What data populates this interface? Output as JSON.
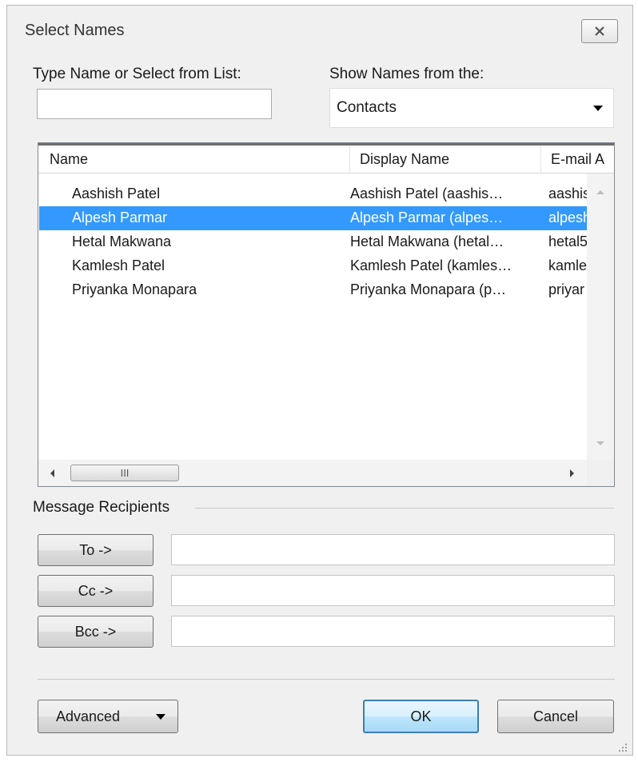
{
  "dialog": {
    "title": "Select Names"
  },
  "search": {
    "label": "Type Name or Select from List:",
    "value": ""
  },
  "address_book": {
    "label": "Show Names from the:",
    "selected": "Contacts"
  },
  "list": {
    "columns": [
      "Name",
      "Display Name",
      "E-mail A"
    ],
    "rows": [
      {
        "name": "Aashish Patel",
        "display": "Aashish Patel (aashis…",
        "email": "aashis",
        "selected": false
      },
      {
        "name": "Alpesh Parmar",
        "display": "Alpesh Parmar (alpes…",
        "email": "alpesh",
        "selected": true
      },
      {
        "name": "Hetal Makwana",
        "display": "Hetal Makwana (hetal…",
        "email": "hetal5",
        "selected": false
      },
      {
        "name": "Kamlesh Patel",
        "display": "Kamlesh Patel (kamles…",
        "email": "kamle",
        "selected": false
      },
      {
        "name": "Priyanka Monapara",
        "display": "Priyanka Monapara (p…",
        "email": "priyar",
        "selected": false
      }
    ],
    "hscroll_thumb": "III"
  },
  "recipients": {
    "group_label": "Message Recipients",
    "to_label": "To ->",
    "cc_label": "Cc ->",
    "bcc_label": "Bcc ->",
    "to_value": "",
    "cc_value": "",
    "bcc_value": ""
  },
  "footer": {
    "advanced_label": "Advanced",
    "ok_label": "OK",
    "cancel_label": "Cancel"
  }
}
